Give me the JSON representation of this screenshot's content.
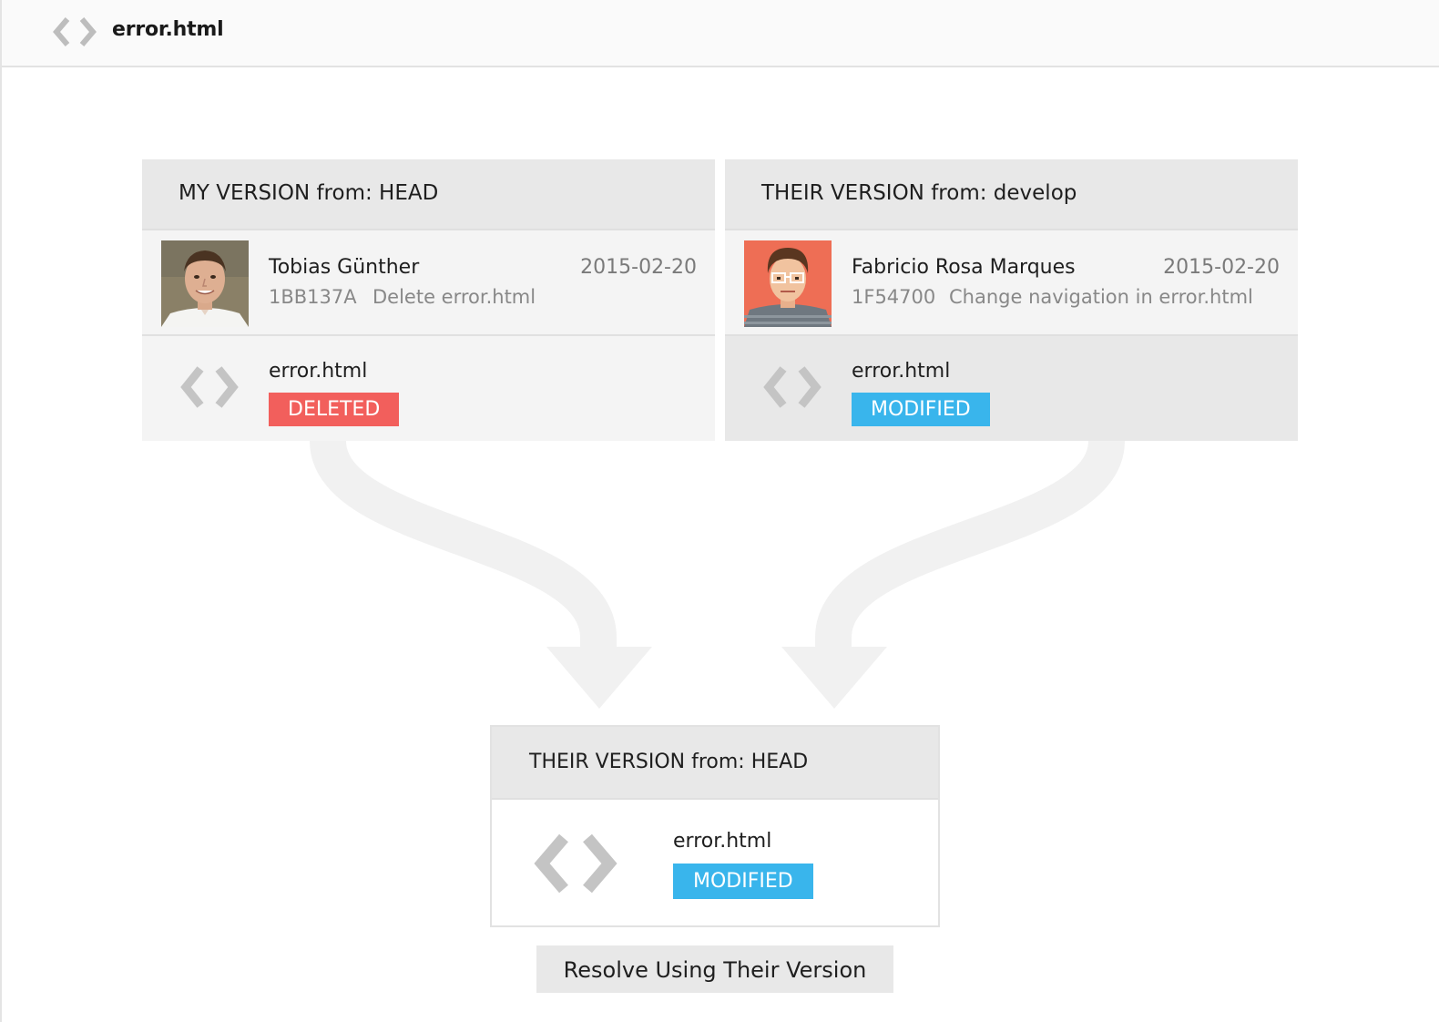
{
  "header": {
    "title": "error.html",
    "icon": "code-icon"
  },
  "my_version": {
    "title": "MY VERSION from: HEAD",
    "commit": {
      "author": "Tobias Günther",
      "date": "2015-02-20",
      "hash": "1BB137A",
      "message": "Delete error.html"
    },
    "file": {
      "name": "error.html",
      "status": "DELETED",
      "status_color": "#f25f5c"
    }
  },
  "their_version": {
    "title": "THEIR VERSION from: develop",
    "commit": {
      "author": "Fabricio Rosa Marques",
      "date": "2015-02-20",
      "hash": "1F54700",
      "message": "Change navigation in error.html"
    },
    "file": {
      "name": "error.html",
      "status": "MODIFIED",
      "status_color": "#39b5ec"
    }
  },
  "result": {
    "title": "THEIR VERSION from: HEAD",
    "file": {
      "name": "error.html",
      "status": "MODIFIED",
      "status_color": "#39b5ec"
    }
  },
  "resolve_button": {
    "label": "Resolve Using Their Version"
  }
}
